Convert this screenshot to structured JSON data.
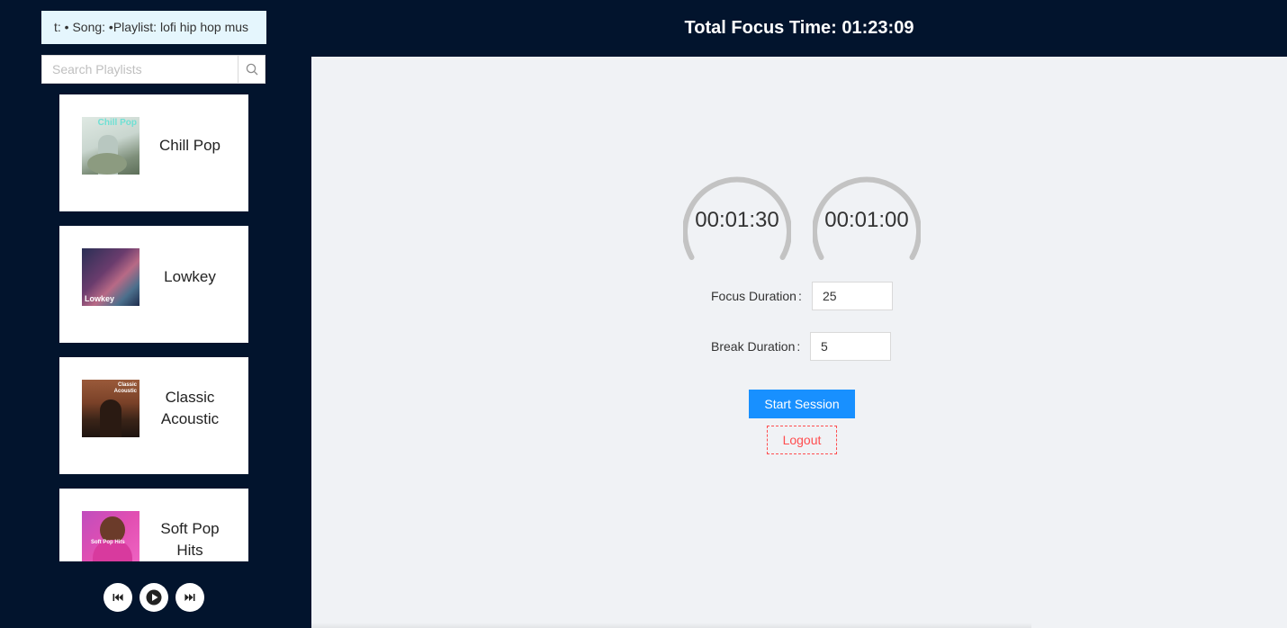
{
  "now_playing": {
    "text": "t: • Song: •Playlist: lofi hip hop mus"
  },
  "search": {
    "placeholder": "Search Playlists",
    "value": ""
  },
  "playlists": [
    {
      "title": "Chill Pop",
      "cover_text": "Chill Pop"
    },
    {
      "title": "Lowkey",
      "cover_text": "Lowkey"
    },
    {
      "title": "Classic Acoustic",
      "cover_text": "Classic Acoustic"
    },
    {
      "title": "Soft Pop Hits",
      "cover_text": "Soft Pop Hits"
    }
  ],
  "player_controls": [
    "previous-icon",
    "play-icon",
    "next-icon"
  ],
  "header": {
    "title": "Total Focus Time: 01:23:09"
  },
  "timers": {
    "focus": "00:01:30",
    "break": "00:01:00"
  },
  "form": {
    "focus_label": "Focus Duration",
    "focus_value": "25",
    "break_label": "Break Duration",
    "break_value": "5",
    "colon": ":"
  },
  "buttons": {
    "start": "Start Session",
    "logout": "Logout"
  },
  "colors": {
    "sidebar": "#02142d",
    "main_bg": "#f0f2f5",
    "primary": "#1890ff",
    "danger": "#ff4d4f",
    "ticker_bg": "#e5f6fd",
    "gauge": "#c3c3c3"
  }
}
